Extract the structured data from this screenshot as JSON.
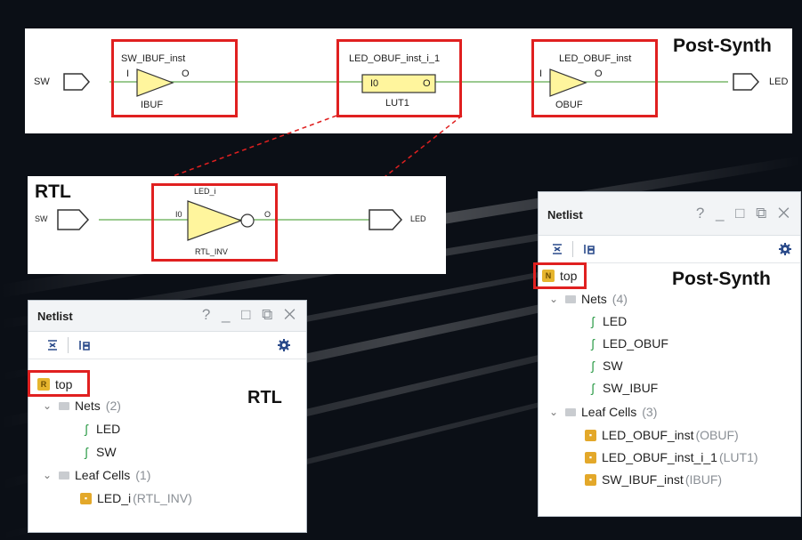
{
  "post_synth_schematic": {
    "title": "Post-Synth",
    "sw_port": "SW",
    "led_port": "LED",
    "ibuf": {
      "instance": "SW_IBUF_inst",
      "pin_in": "I",
      "pin_out": "O",
      "type": "IBUF"
    },
    "lut": {
      "instance": "LED_OBUF_inst_i_1",
      "pin_in": "I0",
      "pin_out": "O",
      "type": "LUT1"
    },
    "obuf": {
      "instance": "LED_OBUF_inst",
      "pin_in": "I",
      "pin_out": "O",
      "type": "OBUF"
    }
  },
  "rtl_schematic": {
    "title": "RTL",
    "sw_port": "SW",
    "led_port": "LED",
    "inv": {
      "instance": "LED_i",
      "pin_in": "I0",
      "pin_out": "O",
      "type": "RTL_INV"
    }
  },
  "netlist_rtl": {
    "panel_title": "Netlist",
    "window_controls": "? _ □ ⧉ ✕",
    "caption": "RTL",
    "top": "top",
    "nets_label": "Nets",
    "nets_count": "(2)",
    "nets": [
      "LED",
      "SW"
    ],
    "cells_label": "Leaf Cells",
    "cells_count": "(1)",
    "cells": [
      {
        "name": "LED_i",
        "type": "(RTL_INV)"
      }
    ]
  },
  "netlist_synth": {
    "panel_title": "Netlist",
    "window_controls": "? _ □ ⧉ ✕",
    "caption": "Post-Synth",
    "top": "top",
    "nets_label": "Nets",
    "nets_count": "(4)",
    "nets": [
      "LED",
      "LED_OBUF",
      "SW",
      "SW_IBUF"
    ],
    "cells_label": "Leaf Cells",
    "cells_count": "(3)",
    "cells": [
      {
        "name": "LED_OBUF_inst",
        "type": "(OBUF)"
      },
      {
        "name": "LED_OBUF_inst_i_1",
        "type": "(LUT1)"
      },
      {
        "name": "SW_IBUF_inst",
        "type": "(IBUF)"
      }
    ]
  },
  "colors": {
    "highlight": "#e02020",
    "wire": "#7ab86b",
    "gate_fill": "#fff59d",
    "background": "#0b0f16"
  },
  "icons": [
    "collapse-all-icon",
    "expand-all-icon",
    "gear-icon",
    "net-icon",
    "leaf-cell-icon",
    "top-module-icon",
    "folder-icon",
    "chevron-down-icon"
  ]
}
